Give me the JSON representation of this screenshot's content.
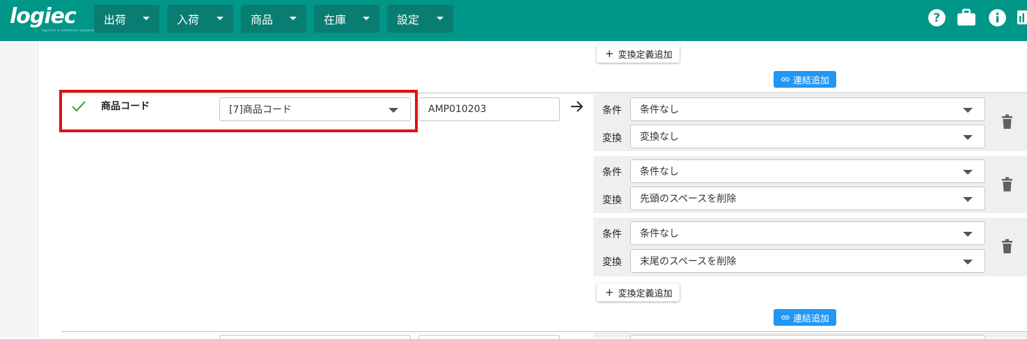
{
  "header": {
    "logo_text": "logiec",
    "logo_subtext": "logistics e-commerce cooperation",
    "brand_color": "#009688",
    "nav": [
      {
        "label": "出荷"
      },
      {
        "label": "入荷"
      },
      {
        "label": "商品"
      },
      {
        "label": "在庫"
      },
      {
        "label": "設定"
      }
    ],
    "icons": [
      "help-icon",
      "briefcase-icon",
      "info-icon",
      "chart-icon"
    ]
  },
  "top": {
    "add_conversion_label": "変換定義追加",
    "add_link_label": "連結追加"
  },
  "mapping": {
    "field_label": "商品コード",
    "column_select_value": "[7]商品コード",
    "sample_value": "AMP010203",
    "rules": [
      {
        "condition_label": "条件",
        "condition_value": "条件なし",
        "transform_label": "変換",
        "transform_value": "変換なし"
      },
      {
        "condition_label": "条件",
        "condition_value": "条件なし",
        "transform_label": "変換",
        "transform_value": "先頭のスペースを削除"
      },
      {
        "condition_label": "条件",
        "condition_value": "条件なし",
        "transform_label": "変換",
        "transform_value": "末尾のスペースを削除"
      }
    ],
    "add_conversion_label": "変換定義追加",
    "add_link_label": "連結追加"
  },
  "colors": {
    "highlight": "#e31010",
    "link_button": "#2196f3",
    "check": "#43a047"
  }
}
